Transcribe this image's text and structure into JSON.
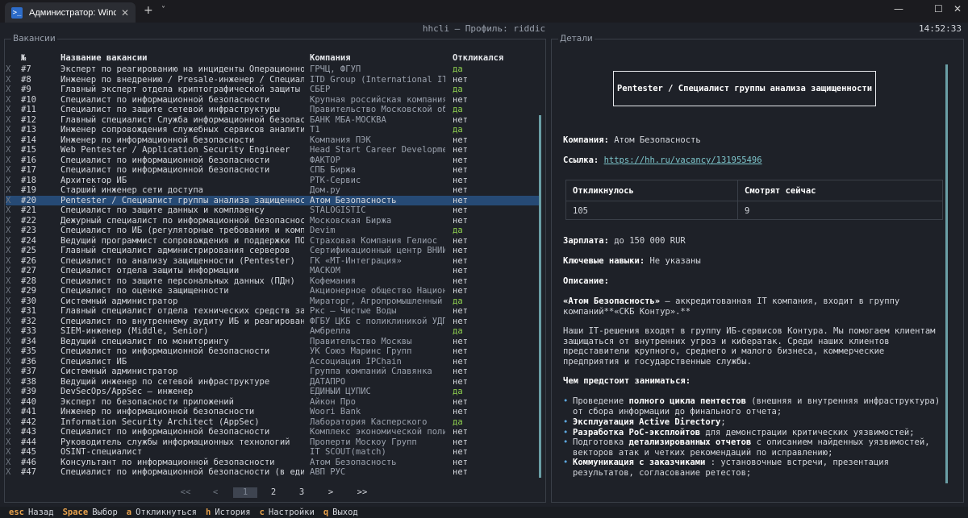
{
  "window": {
    "tab_title": "Администратор: Windows Po",
    "tab_icon": "powershell-icon",
    "new_tab_glyph": "+",
    "dropdown_glyph": "˅",
    "minimize_glyph": "—",
    "maximize_glyph": "☐",
    "close_glyph": "✕"
  },
  "app": {
    "title": "hhcli — Профиль: riddic",
    "clock": "14:52:33"
  },
  "vacancies_panel": {
    "title": "Вакансии",
    "columns": [
      "№",
      "Название вакансии",
      "Компания",
      "Откликался"
    ],
    "rows": [
      {
        "mark": "X",
        "num": "#7",
        "title": "Эксперт по реагированию на инциденты Операционног…",
        "company": "ГРЧЦ, ФГУП",
        "applied": "да"
      },
      {
        "mark": "X",
        "num": "#8",
        "title": "Инженер по внедрению / Presale-инженер / Специали…",
        "company": "ITD Group (International IT…",
        "applied": "нет"
      },
      {
        "mark": "X",
        "num": "#9",
        "title": "Главный эксперт отдела криптографической защиты",
        "company": "СБЕР",
        "applied": "да"
      },
      {
        "mark": "X",
        "num": "#10",
        "title": "Специалист по информационной безопасности",
        "company": "Крупная российская компания…",
        "applied": "нет"
      },
      {
        "mark": "X",
        "num": "#11",
        "title": "Специалист по защите сетевой инфраструктуры",
        "company": "Правительство Московской об…",
        "applied": "да"
      },
      {
        "mark": "X",
        "num": "#12",
        "title": "Главный специалист Служба информационной безопасн…",
        "company": "БАНК МБА-МОСКВА",
        "applied": "нет"
      },
      {
        "mark": "X",
        "num": "#13",
        "title": "Инженер сопровождения служебных сервисов аналитики",
        "company": "Т1",
        "applied": "да"
      },
      {
        "mark": "X",
        "num": "#14",
        "title": "Инженер по информационной безопасности",
        "company": "Компания ПЭК",
        "applied": "нет"
      },
      {
        "mark": "X",
        "num": "#15",
        "title": "Web Pentester / Application Security Engineer",
        "company": "Head Start Career Developme…",
        "applied": "нет"
      },
      {
        "mark": "X",
        "num": "#16",
        "title": "Специалист по информационной безопасности",
        "company": "ФАКТОР",
        "applied": "нет"
      },
      {
        "mark": "X",
        "num": "#17",
        "title": "Специалист по информационной безопасности",
        "company": "СПБ Биржа",
        "applied": "нет"
      },
      {
        "mark": "X",
        "num": "#18",
        "title": "Архитектор ИБ",
        "company": "РТК-Сервис",
        "applied": "нет"
      },
      {
        "mark": "X",
        "num": "#19",
        "title": "Старший инженер сети доступа",
        "company": "Дом.ру",
        "applied": "нет"
      },
      {
        "mark": "X",
        "num": "#20",
        "title": "Pentester / Специалист группы анализа защищенности",
        "company": "Атом Безопасность",
        "applied": "нет"
      },
      {
        "mark": "X",
        "num": "#21",
        "title": "Специалист по защите данных и комплаенсу",
        "company": "STALOGISTIC",
        "applied": "нет"
      },
      {
        "mark": "X",
        "num": "#22",
        "title": "Дежурный специалист по информационной безопасности",
        "company": "Московская Биржа",
        "applied": "нет"
      },
      {
        "mark": "X",
        "num": "#23",
        "title": "Специалист по ИБ (регуляторные требования и компл…",
        "company": "Devim",
        "applied": "да"
      },
      {
        "mark": "X",
        "num": "#24",
        "title": "Ведущий программист сопровождения и поддержки ПО",
        "company": "Страховая Компания Гелиос",
        "applied": "нет"
      },
      {
        "mark": "X",
        "num": "#25",
        "title": "Главный специалист администрирования серверов",
        "company": "Сертификационный центр ВНИИ…",
        "applied": "нет"
      },
      {
        "mark": "X",
        "num": "#26",
        "title": "Специалист по анализу защищенности (Pentester)",
        "company": "ГК «МТ-Интеграция»",
        "applied": "нет"
      },
      {
        "mark": "X",
        "num": "#27",
        "title": "Специалист отдела защиты информации",
        "company": "МАСКОМ",
        "applied": "нет"
      },
      {
        "mark": "X",
        "num": "#28",
        "title": "Специалист по защите персональных данных (ПДн)",
        "company": "Кофемания",
        "applied": "нет"
      },
      {
        "mark": "X",
        "num": "#29",
        "title": "Специалист по оценке защищенности",
        "company": "Акционерное общество Национ…",
        "applied": "нет"
      },
      {
        "mark": "X",
        "num": "#30",
        "title": "Системный администратор",
        "company": "Мираторг, Агропромышленный …",
        "applied": "да"
      },
      {
        "mark": "X",
        "num": "#31",
        "title": "Главный специалист отдела технических средств защ…",
        "company": "Ркс – Чистые Воды",
        "applied": "нет"
      },
      {
        "mark": "X",
        "num": "#32",
        "title": "Специалист по внутреннему аудиту ИБ и реагировани…",
        "company": "ФГБУ ЦКБ с поликлиникой УДП…",
        "applied": "нет"
      },
      {
        "mark": "X",
        "num": "#33",
        "title": "SIEM-инженер (Middle, Senior)",
        "company": "Амбрелла",
        "applied": "да"
      },
      {
        "mark": "X",
        "num": "#34",
        "title": "Ведущий специалист по мониторингу",
        "company": "Правительство Москвы",
        "applied": "нет"
      },
      {
        "mark": "X",
        "num": "#35",
        "title": "Специалист по информационной безопасности",
        "company": "УК Союз Маринс Групп",
        "applied": "нет"
      },
      {
        "mark": "X",
        "num": "#36",
        "title": "Специалист ИБ",
        "company": "Ассоциация IPChain",
        "applied": "нет"
      },
      {
        "mark": "X",
        "num": "#37",
        "title": "Системный администратор",
        "company": "Группа компаний Славянка",
        "applied": "нет"
      },
      {
        "mark": "X",
        "num": "#38",
        "title": "Ведущий инженер по сетевой инфраструктуре",
        "company": "ДАТАПРО",
        "applied": "нет"
      },
      {
        "mark": "X",
        "num": "#39",
        "title": "DevSecOps/AppSec – инженер",
        "company": "ЕДИНЫЙ ЦУПИС",
        "applied": "да"
      },
      {
        "mark": "X",
        "num": "#40",
        "title": "Эксперт по безопасности приложений",
        "company": "Айкон Про",
        "applied": "нет"
      },
      {
        "mark": "X",
        "num": "#41",
        "title": "Инженер по информационной безопасности",
        "company": "Woori Bank",
        "applied": "нет"
      },
      {
        "mark": "X",
        "num": "#42",
        "title": "Information Security Architect (AppSec)",
        "company": "Лаборатория Касперского",
        "applied": "да"
      },
      {
        "mark": "X",
        "num": "#43",
        "title": "Специалист по информационной безопасности",
        "company": "Комплекс экономической поли…",
        "applied": "нет"
      },
      {
        "mark": "X",
        "num": "#44",
        "title": "Руководитель службы информационных технологий",
        "company": "Проперти Москоу Групп",
        "applied": "нет"
      },
      {
        "mark": "X",
        "num": "#45",
        "title": "OSINT-специалист",
        "company": "IT SCOUT(match)",
        "applied": "нет"
      },
      {
        "mark": "X",
        "num": "#46",
        "title": "Консультант по информационной безопасности",
        "company": "Атом Безопасность",
        "applied": "нет"
      },
      {
        "mark": "X",
        "num": "#47",
        "title": "Специалист по информационной безопасности (в един…",
        "company": "АВП РУС",
        "applied": "нет"
      }
    ],
    "selected_row_index": 13,
    "pagination": {
      "first": "<<",
      "prev": "<",
      "p1": "1",
      "p2": "2",
      "p3": "3",
      "next": ">",
      "last": ">>"
    }
  },
  "details_panel": {
    "title": "Детали",
    "vacancy_title": "Pentester / Специалист группы анализа защищенности",
    "company_label": "Компания:",
    "company_value": "Атом Безопасность",
    "link_label": "Ссылка:",
    "link_value": "https://hh.ru/vacancy/131955496",
    "stats_headers": [
      "Откликнулось",
      "Смотрят сейчас"
    ],
    "stats_values": [
      "105",
      "9"
    ],
    "salary_label": "Зарплата:",
    "salary_value": "до 150 000 RUR",
    "skills_label": "Ключевые навыки:",
    "skills_value": "Не указаны",
    "description_label": "Описание:",
    "desc_p1_line1_bold": "«Атом Безопасность»",
    "desc_p1_line1_rest": " – аккредитованная IT компания, входит в группу",
    "desc_p1_line2": "компаний**«СКБ Контур».**",
    "desc_p2": "Наши IT-решения входят в группу ИБ-сервисов Контура. Мы помогаем клиентам защищаться от внутренних угроз и кибератак. Среди наших клиентов представители крупного, среднего и малого бизнеса, коммерческие предприятия и государственные службы.",
    "tasks_heading": "Чем предстоит заниматься:",
    "bullets": [
      {
        "pre": "Проведение ",
        "bold": "полного цикла пентестов",
        "post": " (внешняя и внутренняя инфраструктура) от сбора информации до финального отчета;"
      },
      {
        "pre": "",
        "bold": "Эксплуатация Active Directory",
        "post": ";"
      },
      {
        "pre": "",
        "bold": "Разработка PoC-эксплойтов",
        "post": " для демонстрации критических уязвимостей;"
      },
      {
        "pre": "Подготовка ",
        "bold": "детализированных отчетов",
        "post": " с описанием найденных уязвимостей, векторов атак и четких рекомендаций по исправлению;"
      },
      {
        "pre": "",
        "bold": "Коммуникация с заказчиками",
        "post": " : установочные встречи, презентация результатов, согласование ретестов;"
      }
    ]
  },
  "footer": {
    "keys": [
      {
        "key": "esc",
        "label": "Назад"
      },
      {
        "key": "Space",
        "label": "Выбор"
      },
      {
        "key": "a",
        "label": "Откликнуться"
      },
      {
        "key": "h",
        "label": "История"
      },
      {
        "key": "c",
        "label": "Настройки"
      },
      {
        "key": "q",
        "label": "Выход"
      }
    ]
  },
  "colors": {
    "background": "#1e2128",
    "selected_row": "#264a75",
    "applied_yes": "#8fd14f",
    "footer_key": "#e8a24c",
    "link": "#7ec6cc",
    "bullet": "#5da8e0"
  }
}
